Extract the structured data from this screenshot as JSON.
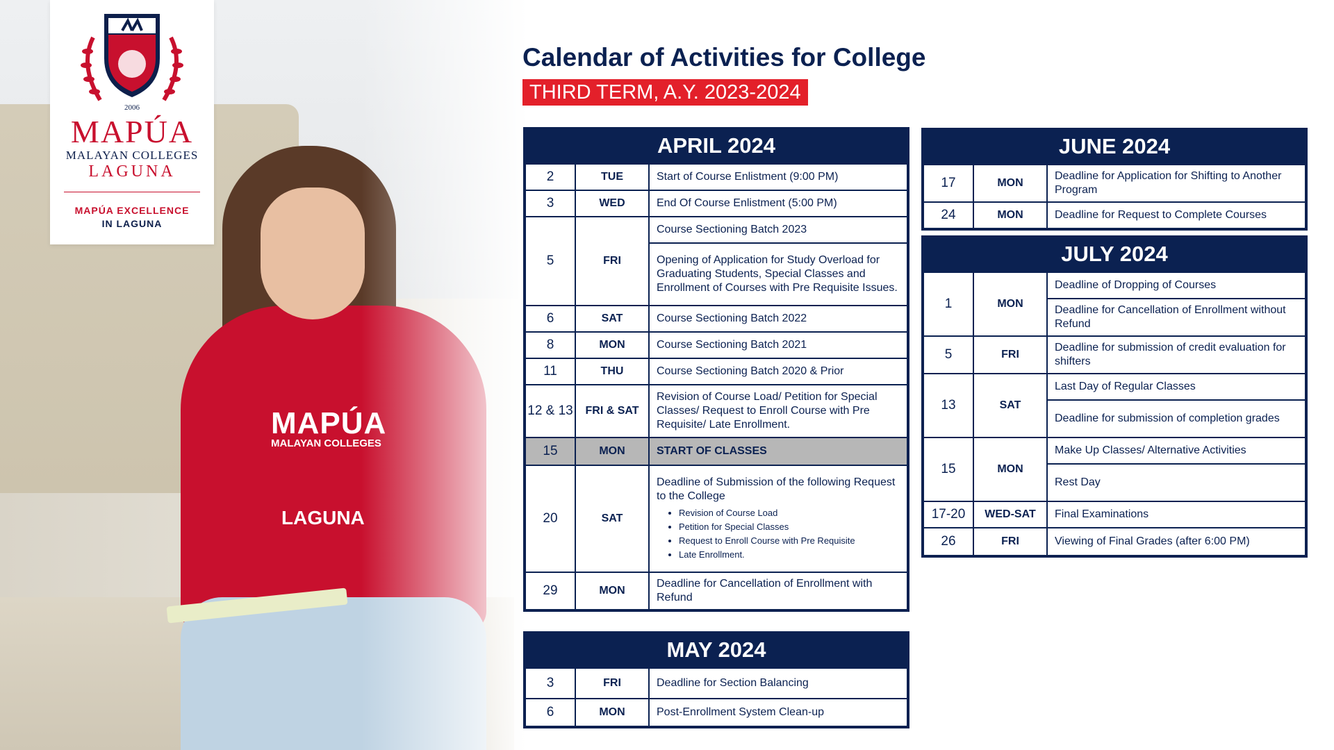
{
  "logo": {
    "year": "2006",
    "name": "MAPÚA",
    "college": "MALAYAN COLLEGES",
    "campus": "LAGUNA",
    "tagline_1": "MAPÚA EXCELLENCE",
    "tagline_2": "IN LAGUNA"
  },
  "photo": {
    "hoodie_line_1": "MAPÚA",
    "hoodie_line_2": "MALAYAN COLLEGES",
    "hoodie_line_3": "LAGUNA"
  },
  "header": {
    "title": "Calendar of Activities for College",
    "subtitle": "THIRD TERM, A.Y. 2023-2024"
  },
  "colors": {
    "navy": "#0b2151",
    "red": "#e3202a",
    "highlight_gray": "#b7b7b7"
  },
  "april": {
    "heading": "APRIL 2024",
    "rows": [
      {
        "day": "2",
        "dow": "TUE",
        "activity": "Start of Course Enlistment (9:00 PM)"
      },
      {
        "day": "3",
        "dow": "WED",
        "activity": "End Of Course Enlistment (5:00 PM)"
      },
      {
        "day": "5",
        "dow": "FRI",
        "activity": "Course Sectioning Batch 2023",
        "activity_2": "Opening of Application for Study Overload for Graduating Students, Special Classes and Enrollment of Courses with Pre Requisite Issues."
      },
      {
        "day": "6",
        "dow": "SAT",
        "activity": "Course Sectioning Batch 2022"
      },
      {
        "day": "8",
        "dow": "MON",
        "activity": "Course Sectioning Batch 2021"
      },
      {
        "day": "11",
        "dow": "THU",
        "activity": "Course Sectioning Batch 2020 & Prior"
      },
      {
        "day": "12 & 13",
        "dow": "FRI & SAT",
        "activity": "Revision of Course Load/ Petition for Special Classes/ Request to Enroll Course with Pre Requisite/ Late Enrollment."
      },
      {
        "day": "15",
        "dow": "MON",
        "activity": "START OF CLASSES"
      },
      {
        "day": "20",
        "dow": "SAT",
        "activity": "Deadline of Submission of the following Request to the College",
        "bullets": [
          "Revision of Course Load",
          "Petition for Special Classes",
          "Request to Enroll Course with Pre Requisite",
          "Late Enrollment."
        ]
      },
      {
        "day": "29",
        "dow": "MON",
        "activity": "Deadline for Cancellation of Enrollment with Refund"
      }
    ]
  },
  "may": {
    "heading": "MAY 2024",
    "rows": [
      {
        "day": "3",
        "dow": "FRI",
        "activity": "Deadline for Section Balancing"
      },
      {
        "day": "6",
        "dow": "MON",
        "activity": "Post-Enrollment System Clean-up"
      }
    ]
  },
  "june": {
    "heading": "JUNE 2024",
    "rows": [
      {
        "day": "17",
        "dow": "MON",
        "activity": "Deadline for Application for Shifting to Another Program"
      },
      {
        "day": "24",
        "dow": "MON",
        "activity": "Deadline for Request to Complete Courses"
      }
    ]
  },
  "july": {
    "heading": "JULY 2024",
    "rows": [
      {
        "day": "1",
        "dow": "MON",
        "activity": "Deadline of Dropping of Courses",
        "activity_2": "Deadline for Cancellation of Enrollment without Refund"
      },
      {
        "day": "5",
        "dow": "FRI",
        "activity": "Deadline for submission of credit evaluation for shifters"
      },
      {
        "day": "13",
        "dow": "SAT",
        "activity": "Last Day of Regular Classes",
        "activity_2": "Deadline for submission of completion grades"
      },
      {
        "day": "15",
        "dow": "MON",
        "activity": "Make Up Classes/ Alternative Activities",
        "activity_2": "Rest Day"
      },
      {
        "day": "17-20",
        "dow": "WED-SAT",
        "activity": "Final Examinations"
      },
      {
        "day": "26",
        "dow": "FRI",
        "activity": "Viewing of Final Grades (after 6:00 PM)"
      }
    ]
  }
}
